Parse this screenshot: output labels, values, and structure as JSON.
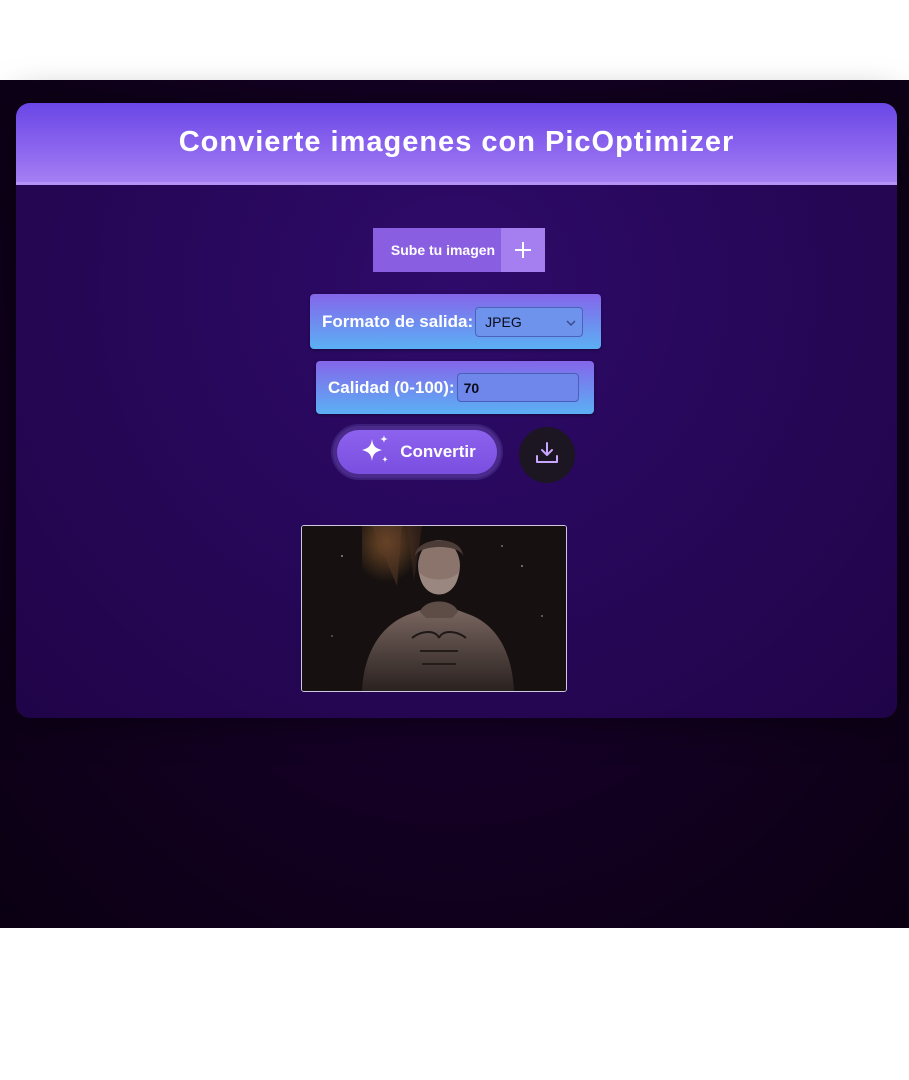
{
  "header": {
    "title": "Convierte imagenes con PicOptimizer"
  },
  "upload": {
    "label": "Sube tu imagen",
    "icon": "plus-icon"
  },
  "format": {
    "label": "Formato de salida:",
    "selected": "JPEG"
  },
  "quality": {
    "label": "Calidad (0-100):",
    "value": "70"
  },
  "convert": {
    "label": "Convertir",
    "icon": "sparkles-icon"
  },
  "download": {
    "icon": "download-icon"
  },
  "preview": {
    "subject": "bearded-statue-image"
  },
  "colors": {
    "header_gradient_start": "#6a47e6",
    "header_gradient_end": "#a47ff3",
    "card_background": "#250655",
    "pill_gradient_start": "#8466ea",
    "pill_gradient_end": "#5bb0f4",
    "button_purple": "#8a5ee0"
  }
}
